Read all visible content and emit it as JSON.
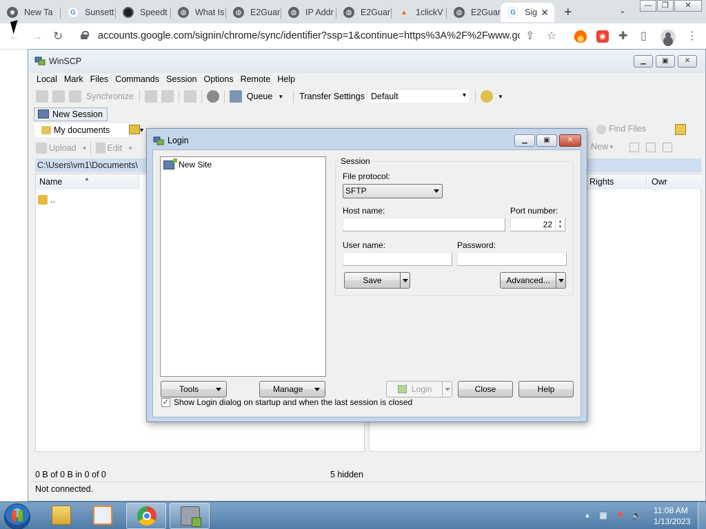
{
  "chrome": {
    "tabs": [
      {
        "title": "New Ta",
        "icon": "chrome-icon"
      },
      {
        "title": "Sunsett",
        "icon": "google-icon"
      },
      {
        "title": "Speedt",
        "icon": "speedtest-icon"
      },
      {
        "title": "What Is",
        "icon": "globe-icon"
      },
      {
        "title": "E2Guar",
        "icon": "globe-icon"
      },
      {
        "title": "IP Addr",
        "icon": "globe-icon"
      },
      {
        "title": "E2Guar",
        "icon": "globe-icon"
      },
      {
        "title": "1clickV",
        "icon": "oneclick-icon"
      },
      {
        "title": "E2Guar",
        "icon": "globe-icon"
      },
      {
        "title": "Sig",
        "icon": "google-icon",
        "active": true
      }
    ],
    "new_tab_glyph": "+",
    "tab_search_glyph": "⌄",
    "url": "accounts.google.com/signin/chrome/sync/identifier?ssp=1&continue=https%3A%2F%2Fwww.go...",
    "window_controls": {
      "minimize": "—",
      "maximize": "❐",
      "close": "✕"
    }
  },
  "winscp": {
    "title": "WinSCP",
    "menu": [
      "Local",
      "Mark",
      "Files",
      "Commands",
      "Session",
      "Options",
      "Remote",
      "Help"
    ],
    "toolbar": {
      "synchronize": "Synchronize",
      "queue": "Queue",
      "transfer_settings_label": "Transfer Settings",
      "transfer_settings_value": "Default"
    },
    "session_tab": "New Session",
    "local": {
      "path_combo": "My documents",
      "upload": "Upload",
      "edit": "Edit",
      "path": "C:\\Users\\vm1\\Documents\\",
      "columns": [
        "Name"
      ],
      "rows": [
        ".."
      ]
    },
    "remote": {
      "find_files": "Find Files",
      "new": "New",
      "columns": [
        "Rights",
        "Owr"
      ]
    },
    "status": {
      "local_summary": "0 B of 0 B in 0 of 0",
      "hidden": "5 hidden",
      "connection": "Not connected."
    }
  },
  "login": {
    "title": "Login",
    "site_tree": [
      "New Site"
    ],
    "session_group": "Session",
    "file_protocol_label": "File protocol:",
    "file_protocol_value": "SFTP",
    "host_label": "Host name:",
    "host_value": "",
    "port_label": "Port number:",
    "port_value": "22",
    "user_label": "User name:",
    "user_value": "",
    "password_label": "Password:",
    "password_value": "",
    "buttons": {
      "save": "Save",
      "advanced": "Advanced...",
      "tools": "Tools",
      "manage": "Manage",
      "login": "Login",
      "close": "Close",
      "help": "Help"
    },
    "show_on_startup": "Show Login dialog on startup and when the last session is closed",
    "show_on_startup_checked": "✓"
  },
  "taskbar": {
    "time": "11:08 AM",
    "date": "1/13/2023"
  }
}
